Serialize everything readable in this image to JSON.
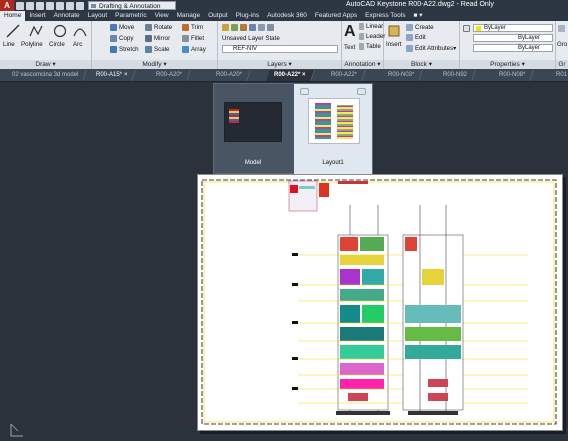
{
  "window": {
    "title": "AutoCAD Keystone   R00-A22.dwg2 - Read Only",
    "workspace": "Drafting & Annotation"
  },
  "ribbon_tabs": [
    "Home",
    "Insert",
    "Annotate",
    "Layout",
    "Parametric",
    "View",
    "Manage",
    "Output",
    "Plug-ins",
    "Autodesk 360",
    "Featured Apps",
    "Express Tools"
  ],
  "active_ribbon_tab": "Home",
  "panels": {
    "draw": {
      "title": "Draw",
      "buttons": [
        "Line",
        "Polyline",
        "Circle",
        "Arc"
      ]
    },
    "modify": {
      "title": "Modify",
      "buttons": [
        "Move",
        "Rotate",
        "Trim",
        "Copy",
        "Mirror",
        "Fillet",
        "Stretch",
        "Scale",
        "Array"
      ]
    },
    "layers": {
      "title": "Layers",
      "state": "Unsaved Layer State",
      "current": "REF-NIV"
    },
    "annotation": {
      "title": "Annotation",
      "text": "Text",
      "dim": "Linear",
      "leader": "Leader",
      "table": "Table"
    },
    "block": {
      "title": "Block",
      "insert": "Insert",
      "create": "Create",
      "edit": "Edit",
      "attrs": "Edit Attributes"
    },
    "properties": {
      "title": "Properties",
      "color": "ByLayer",
      "linetype": "ByLayer",
      "lineweight": "ByLayer"
    },
    "groups": {
      "label": "Gro",
      "title": "Gr"
    }
  },
  "doc_tabs": [
    "02 vascomcina 3d model",
    "R00-A15*",
    "R00-A20*",
    "R00-A20*",
    "R00-A22*",
    "R00-A22*",
    "R00-N03*",
    "R00-N92",
    "R00-N08*",
    "R01"
  ],
  "active_doc_tab": "R00-A22*",
  "layout_popup": {
    "items": [
      "Model",
      "Layout1"
    ],
    "selected": "Layout1"
  },
  "colors": {
    "ribbon_bg": "#e7ebf0",
    "title_bg": "#2d3744",
    "canvas_bg": "#2b323b",
    "sheet_bg": "#ffffff",
    "accent_red": "#b3261e"
  }
}
